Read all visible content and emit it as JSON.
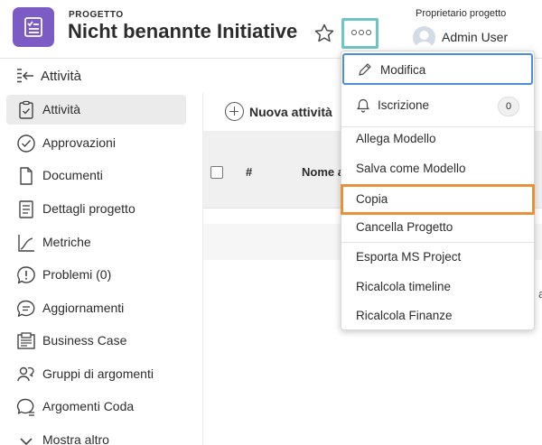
{
  "header": {
    "eyebrow": "PROGETTO",
    "title": "Nicht benannte Initiative",
    "owner_label": "Proprietario progetto",
    "owner_name": "Admin User"
  },
  "panel": {
    "title": "Attività"
  },
  "sidebar": {
    "items": [
      {
        "label": "Attività",
        "icon": "clipboard-check-icon",
        "active": true
      },
      {
        "label": "Approvazioni",
        "icon": "check-circle-icon"
      },
      {
        "label": "Documenti",
        "icon": "document-icon"
      },
      {
        "label": "Dettagli progetto",
        "icon": "details-icon"
      },
      {
        "label": "Metriche",
        "icon": "chart-line-icon"
      },
      {
        "label": "Problemi (0)",
        "icon": "speech-bubble-exclamation-icon"
      },
      {
        "label": "Aggiornamenti",
        "icon": "chat-bubble-icon"
      },
      {
        "label": "Business Case",
        "icon": "business-case-icon"
      },
      {
        "label": "Gruppi di argomenti",
        "icon": "people-group-icon"
      },
      {
        "label": "Argomenti Coda",
        "icon": "queue-topics-icon"
      },
      {
        "label": "Mostra altro",
        "icon": "chevron-down-icon"
      }
    ]
  },
  "main": {
    "new_task_label": "Nuova attività",
    "columns": [
      "#",
      "Nome a"
    ],
    "edge_fragment": "a"
  },
  "menu": {
    "edit_label": "Modifica",
    "subscribe_label": "Iscrizione",
    "subscribe_count": "0",
    "items_group1": [
      "Allega Modello",
      "Salva come Modello"
    ],
    "copy_label": "Copia",
    "delete_label": "Cancella Progetto",
    "items_group2": [
      "Esporta MS Project",
      "Ricalcola timeline",
      "Ricalcola Finanze"
    ]
  },
  "colors": {
    "app_tile": "#7c5cc4",
    "more_button_highlight": "#6fc4c4",
    "copy_highlight": "#e8913b",
    "edit_focus": "#4d8fd6"
  }
}
